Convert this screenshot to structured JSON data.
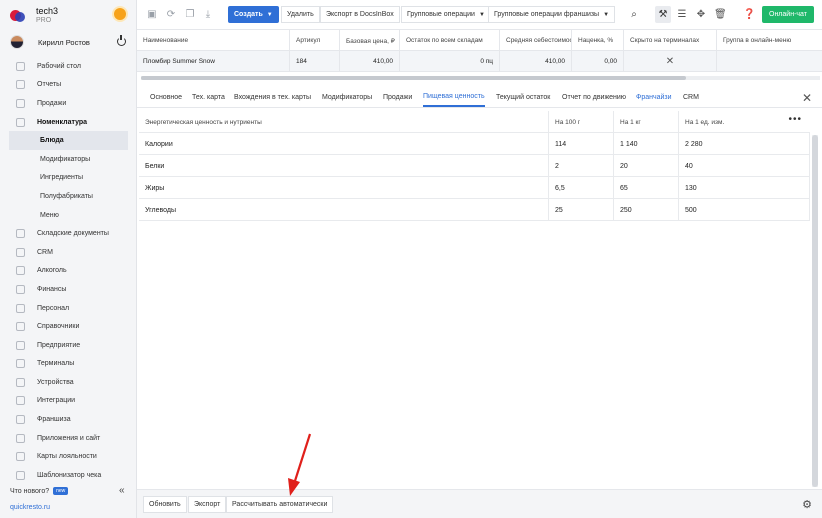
{
  "brand": {
    "name": "tech3",
    "plan": "PRO"
  },
  "user": {
    "name": "Кирилл Ростов"
  },
  "sidebar": {
    "items": [
      {
        "label": "Рабочий стол"
      },
      {
        "label": "Отчеты"
      },
      {
        "label": "Продажи"
      },
      {
        "label": "Номенклатура"
      }
    ],
    "subitems": [
      {
        "label": "Блюда"
      },
      {
        "label": "Модификаторы"
      },
      {
        "label": "Ингредиенты"
      },
      {
        "label": "Полуфабрикаты"
      },
      {
        "label": "Меню"
      }
    ],
    "items2": [
      {
        "label": "Складские документы"
      },
      {
        "label": "CRM"
      },
      {
        "label": "Алкоголь"
      },
      {
        "label": "Финансы"
      },
      {
        "label": "Персонал"
      },
      {
        "label": "Справочники"
      },
      {
        "label": "Предприятие"
      },
      {
        "label": "Терминалы"
      },
      {
        "label": "Устройства"
      },
      {
        "label": "Интеграции"
      },
      {
        "label": "Франшиза"
      },
      {
        "label": "Приложения и сайт"
      },
      {
        "label": "Карты лояльности"
      },
      {
        "label": "Шаблонизатор чека"
      }
    ],
    "whats_new": "Что нового?",
    "new_badge": "new",
    "collapse": "«",
    "site": "quickresto.ru"
  },
  "toolbar": {
    "create": "Создать",
    "delete": "Удалить",
    "export_docsinbox": "Экспорт в DocsInBox",
    "group_ops": "Групповые операции",
    "group_ops_franchise": "Групповые операции франшизы",
    "chat": "Онлайн-чат"
  },
  "grid": {
    "headers": [
      "Наименование",
      "Артикул",
      "Базовая цена, ₽",
      "Остаток по всем складам",
      "Средняя себестоимость",
      "Наценка, %",
      "Скрыто на терминалах",
      "Группа в онлайн-меню"
    ],
    "row": [
      "Пломбир Summer Snow",
      "184",
      "410,00",
      "0 пц",
      "410,00",
      "0,00",
      "✕",
      ""
    ]
  },
  "tabs": [
    {
      "label": "Основное"
    },
    {
      "label": "Тех. карта"
    },
    {
      "label": "Вхождения в тех. карты"
    },
    {
      "label": "Модификаторы"
    },
    {
      "label": "Продажи"
    },
    {
      "label": "Пищевая ценность"
    },
    {
      "label": "Текущий остаток"
    },
    {
      "label": "Отчет по движению"
    },
    {
      "label": "Франчайзи"
    },
    {
      "label": "CRM"
    }
  ],
  "nutrition": {
    "headers": [
      "Энергетическая ценность и нутриенты",
      "На 100 г",
      "На 1 кг",
      "На 1 ед. изм."
    ],
    "rows": [
      [
        "Калории",
        "114",
        "1 140",
        "2 280"
      ],
      [
        "Белки",
        "2",
        "20",
        "40"
      ],
      [
        "Жиры",
        "6,5",
        "65",
        "130"
      ],
      [
        "Углеводы",
        "25",
        "250",
        "500"
      ]
    ]
  },
  "bottom": {
    "refresh": "Обновить",
    "export": "Экспорт",
    "auto_calc": "Рассчитывать автоматически"
  },
  "colors": {
    "accent": "#2f6fd6",
    "chat": "#1fb86a",
    "arrow": "#e0201b"
  }
}
